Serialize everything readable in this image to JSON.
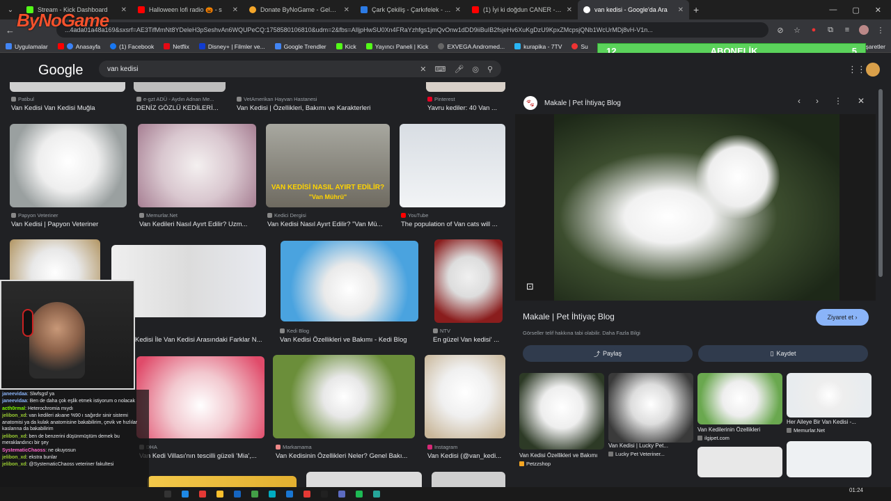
{
  "browser": {
    "tabs": [
      {
        "label": "Stream - Kick Dashboard",
        "color": "#53fc18"
      },
      {
        "label": "Halloween lofi radio 🎃 - s",
        "color": "#ff0000"
      },
      {
        "label": "Donate ByNoGame - Gelen/Gid",
        "color": "#f4a62a"
      },
      {
        "label": "Çark Çekiliş - Çarkıfelek - Hızlı",
        "color": "#2c7be5"
      },
      {
        "label": "(1) İyi ki doğdun CANER - İsme",
        "color": "#ff0000"
      },
      {
        "label": "van kedisi - Google'da Ara",
        "color": "#ffffff"
      }
    ],
    "url": "...4ada01a48a169&sxsrf=AE3TifMmNt8YDeleH3pSeshvAn6WQUPeCQ:1758580106810&udm=2&fbs=AIljpHwSU0Xn4FRaYzhfgs1jmQvOnw1dDD9iiBuIB2fsjeHv6XuKgDzU9KpxZMcpsjQNb1WcUrMDj8vH-V1n...",
    "bookmarks": [
      "Uygulamalar",
      "Anasayfa",
      "(1) Facebook",
      "Netflix",
      "Disney+ | Filmler ve...",
      "Google Trendler",
      "Kick",
      "Yayıncı Paneli | Kick",
      "EXVEGA Andromed...",
      "kurapika - 7TV",
      "Su",
      "r İşaretler"
    ]
  },
  "overlay": {
    "logo_text": "ByNoGame",
    "abonelik_left": "12",
    "abonelik_label": "ABONELİK",
    "abonelik_right": "5"
  },
  "google": {
    "logo": "Google",
    "query": "van kedisi"
  },
  "results": [
    {
      "source": "Patibul",
      "caption": "Van Kedisi Van Kedisi Muğla"
    },
    {
      "source": "e-gzt ADÜ - Aydın Adnan Me...",
      "caption": "DENİZ GÖZLÜ KEDİLERİ..."
    },
    {
      "source": "VetAmerikan Hayvan Hastanesi",
      "caption": "Van Kedisi | Özellikleri, Bakımı ve Karakterleri"
    },
    {
      "source": "Pinterest",
      "caption": "Yavru kediler: 40 Van ..."
    },
    {
      "source": "Papyon Veteriner",
      "caption": "Van Kedisi | Papyon Veteriner"
    },
    {
      "source": "Memurlar.Net",
      "caption": "Van Kedileri Nasıl Ayırt Edilir? Uzm..."
    },
    {
      "source": "Kedici Dergisi",
      "caption": "Van Kedisi Nasıl Ayırt Edilir? \"Van Mü..."
    },
    {
      "source": "YouTube",
      "caption": "The population of Van cats will ..."
    },
    {
      "source": "",
      "caption": "Kedisi İle Van Kedisi Arasındaki Farklar N..."
    },
    {
      "source": "Kedi Blog",
      "caption": "Van Kedisi Özellikleri ve Bakımı - Kedi Blog"
    },
    {
      "source": "NTV",
      "caption": "En güzel Van kedisi' ..."
    },
    {
      "source": "DHA",
      "caption": "Van Kedi Villası'nın tescilli güzeli 'Mia',..."
    },
    {
      "source": "Markamama",
      "caption": "Van Kedisinin Özellikleri Neler? Genel Bakı..."
    },
    {
      "source": "Instagram",
      "caption": "Van Kedisi (@van_kedi..."
    }
  ],
  "thumb_overlay": {
    "line1": "VAN KEDİSİ NASIL AYIRT EDİLİR?",
    "line2": "\"Van Mührü\""
  },
  "panel": {
    "site": "Makale | Pet İhtiyaç Blog",
    "title": "Makale | Pet İhtiyaç Blog",
    "note": "Görseller telif hakkına tabi olabilir. Daha Fazla Bilgi",
    "visit": "Ziyaret et",
    "share": "Paylaş",
    "save": "Kaydet",
    "related": [
      {
        "caption": "Van Kedisi Özellikleri ve Bakımı",
        "source": "Petzzshop"
      },
      {
        "caption": "Van Kedisi | Lucky Pet...",
        "source": "Lucky Pet Veteriner..."
      },
      {
        "caption": "Van Kedilerinin Özellikleri",
        "source": "ilgipet.com"
      },
      {
        "caption": "Her Aileye Bir Van Kedisi -...",
        "source": "Memurlar.Net"
      }
    ]
  },
  "chat": [
    {
      "user": "janeevidaa",
      "msg": "Slwfsgsf ya",
      "color": "#8ab4f8"
    },
    {
      "user": "janeevidaa",
      "msg": "Ben de daha çok eşlik etmek istiyorum o nolacak",
      "color": "#8ab4f8"
    },
    {
      "user": "acth0rmal",
      "msg": "Heterochromia mıydı",
      "color": "#7cfc00"
    },
    {
      "user": "jelibon_xd",
      "msg": "van kedileri akıane %90 ı sağırdır sinir sistemi anatomisi ya da kulak anatomisine bakabilirim, çevik ve hızlılar kaslarına da bakabilirim",
      "color": "#9acd32"
    },
    {
      "user": "jelibon_xd",
      "msg": "ben de benzerini düşünmüştüm demek bu meraklandırıcı bir şey",
      "color": "#9acd32"
    },
    {
      "user": "SystematicChaoss",
      "msg": "ne okuyosun",
      "color": "#ff66cc"
    },
    {
      "user": "jelibon_xd",
      "msg": "ekstra bunlar",
      "color": "#9acd32"
    },
    {
      "user": "jelibon_xd",
      "msg": "@SystematicChaoss veteriner fakultesi",
      "color": "#9acd32"
    }
  ],
  "clock": {
    "time": "01:24",
    "date": ""
  }
}
